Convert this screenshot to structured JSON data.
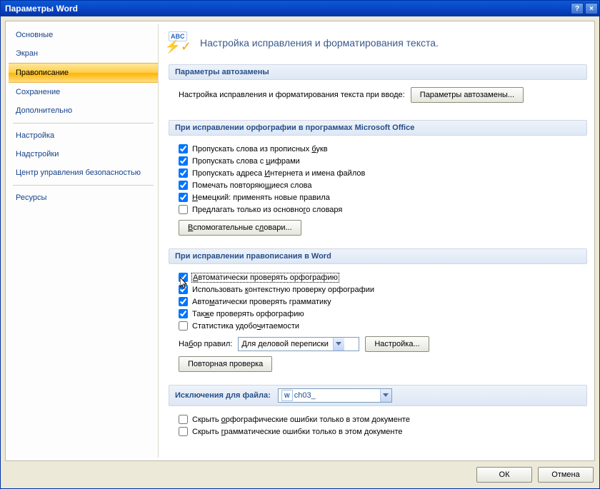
{
  "window": {
    "title": "Параметры Word",
    "help_label": "?",
    "close_label": "×"
  },
  "sidebar": {
    "items": [
      {
        "label": "Основные"
      },
      {
        "label": "Экран"
      },
      {
        "label": "Правописание",
        "selected": true
      },
      {
        "label": "Сохранение"
      },
      {
        "label": "Дополнительно"
      }
    ],
    "items2": [
      {
        "label": "Настройка"
      },
      {
        "label": "Надстройки"
      },
      {
        "label": "Центр управления безопасностью"
      }
    ],
    "items3": [
      {
        "label": "Ресурсы"
      }
    ]
  },
  "page": {
    "icon_abc": "ABC",
    "heading": "Настройка исправления и форматирования текста."
  },
  "sections": {
    "autocorrect": {
      "title": "Параметры автозамены",
      "desc": "Настройка исправления и форматирования текста при вводе:",
      "button": "Параметры автозамены..."
    },
    "office_spelling": {
      "title": "При исправлении орфографии в программах Microsoft Office",
      "checks": [
        {
          "label_pre": "Пропускать слова из прописных ",
          "u": "б",
          "label_post": "укв",
          "checked": true
        },
        {
          "label_pre": "Пропускать слова с ",
          "u": "ц",
          "label_post": "ифрами",
          "checked": true
        },
        {
          "label_pre": "Пропускать адреса ",
          "u": "И",
          "label_post": "нтернета и имена файлов",
          "checked": true
        },
        {
          "label_pre": "Помечать повторяю",
          "u": "щ",
          "label_post": "иеся слова",
          "checked": true
        },
        {
          "label_pre": "",
          "u": "Н",
          "label_post": "емецкий: применять новые правила",
          "checked": true
        },
        {
          "label_pre": "Предлагать только из основно",
          "u": "г",
          "label_post": "о словаря",
          "checked": false
        }
      ],
      "aux_button": "Вспомогательные словари..."
    },
    "word_spelling": {
      "title": "При исправлении правописания в Word",
      "checks": [
        {
          "label_pre": "",
          "u": "А",
          "label_post": "втоматически проверять орфографию",
          "checked": true,
          "focused": true
        },
        {
          "label_pre": "Использовать ",
          "u": "к",
          "label_post": "онтекстную проверку орфографии",
          "checked": true
        },
        {
          "label_pre": "Авто",
          "u": "м",
          "label_post": "атически проверять грамматику",
          "checked": true
        },
        {
          "label_pre": "Так",
          "u": "ж",
          "label_post": "е проверять орфографию",
          "checked": true
        },
        {
          "label_pre": "Статистика удобо",
          "u": "ч",
          "label_post": "итаемости",
          "checked": false
        }
      ],
      "rules_label": "Набор правил:",
      "rules_value": "Для деловой переписки",
      "settings_button": "Настройка...",
      "recheck_button": "Повторная проверка"
    },
    "exceptions": {
      "title_prefix": "Исключения для файла:",
      "file_value": "ch03_",
      "checks": [
        {
          "label_pre": "Скрыть ",
          "u": "о",
          "label_post": "рфографические ошибки только в этом документе",
          "checked": false
        },
        {
          "label_pre": "Скрыть ",
          "u": "г",
          "label_post": "рамматические ошибки только в этом документе",
          "checked": false
        }
      ]
    }
  },
  "footer": {
    "ok": "ОК",
    "cancel": "Отмена"
  }
}
